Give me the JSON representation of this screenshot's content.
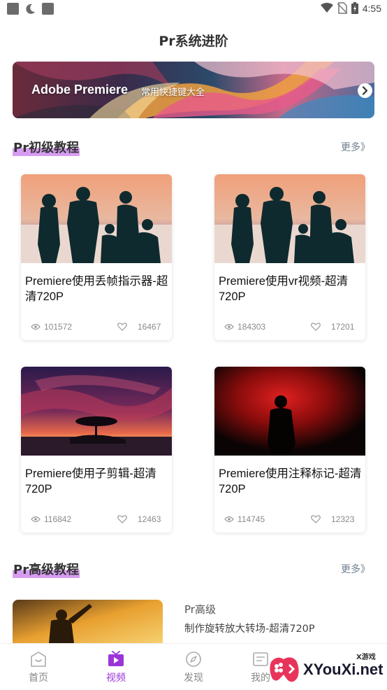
{
  "status_bar": {
    "time": "4:55",
    "left_icons": [
      "notification-square-icon",
      "do-not-disturb-moon-icon",
      "notification-square-icon"
    ],
    "right_icons": [
      "wifi-icon",
      "no-sim-icon",
      "battery-charging-icon"
    ]
  },
  "header": {
    "title": "Pr系统进阶"
  },
  "banner": {
    "title": "Adobe Premiere",
    "subtitle": "常用快捷键大全",
    "arrow_icon": "chevron-right-circle-icon"
  },
  "section_basic": {
    "title": "Pr初级教程",
    "more": "更多》",
    "accent": "#d79cf2",
    "cards": [
      {
        "title": "Premiere使用丢帧指示器-超清720P",
        "views": "101572",
        "likes": "16467"
      },
      {
        "title": "Premiere使用vr视频-超清720P",
        "views": "184303",
        "likes": "17201"
      },
      {
        "title": "Premiere使用子剪辑-超清720P",
        "views": "116842",
        "likes": "12463"
      },
      {
        "title": "Premiere使用注释标记-超清720P",
        "views": "114745",
        "likes": "12323"
      }
    ]
  },
  "section_advanced": {
    "title": "Pr高级教程",
    "more": "更多》",
    "items": [
      {
        "category": "Pr高级",
        "title": "制作旋转放大转场-超清720P"
      }
    ]
  },
  "bottom_nav": {
    "active_color": "#9b35d8",
    "items": [
      {
        "label": "首页",
        "icon": "home-icon"
      },
      {
        "label": "视频",
        "icon": "tv-icon"
      },
      {
        "label": "发现",
        "icon": "compass-icon"
      },
      {
        "label": "我的",
        "icon": "profile-icon"
      }
    ]
  },
  "watermark": {
    "text": "XYouXi.net",
    "small": "X游戏"
  }
}
